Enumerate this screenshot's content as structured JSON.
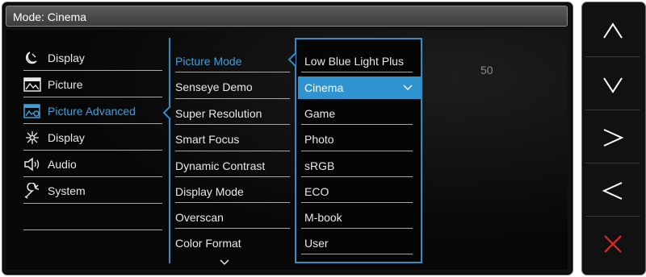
{
  "header": {
    "title": "Mode: Cinema"
  },
  "menu": {
    "items": [
      {
        "label": "Display",
        "icon": "moon-icon"
      },
      {
        "label": "Picture",
        "icon": "picture-icon"
      },
      {
        "label": "Picture Advanced",
        "icon": "picture-advanced-icon",
        "selected": true
      },
      {
        "label": "Display",
        "icon": "display-sparkle-icon"
      },
      {
        "label": "Audio",
        "icon": "speaker-icon"
      },
      {
        "label": "System",
        "icon": "wrench-icon"
      }
    ]
  },
  "submenu": {
    "items": [
      {
        "label": "Picture Mode",
        "selected": true
      },
      {
        "label": "Senseye Demo"
      },
      {
        "label": "Super Resolution"
      },
      {
        "label": "Smart Focus"
      },
      {
        "label": "Dynamic Contrast"
      },
      {
        "label": "Display Mode"
      },
      {
        "label": "Overscan"
      },
      {
        "label": "Color Format"
      }
    ],
    "more_icon": "chevron-down-icon"
  },
  "options": {
    "items": [
      {
        "label": "Low Blue Light Plus"
      },
      {
        "label": "Cinema",
        "selected": true
      },
      {
        "label": "Game"
      },
      {
        "label": "Photo"
      },
      {
        "label": "sRGB"
      },
      {
        "label": "ECO"
      },
      {
        "label": "M-book"
      },
      {
        "label": "User"
      }
    ]
  },
  "value": "50",
  "controls": [
    {
      "name": "up-button",
      "icon": "up-chevron-icon"
    },
    {
      "name": "down-button",
      "icon": "down-chevron-icon"
    },
    {
      "name": "right-button",
      "icon": "right-chevron-icon"
    },
    {
      "name": "left-button",
      "icon": "left-chevron-icon"
    },
    {
      "name": "exit-button",
      "icon": "close-icon"
    }
  ],
  "colors": {
    "accent": "#2f93cf",
    "selected_text": "#39a2db",
    "close": "#e02a2a"
  }
}
